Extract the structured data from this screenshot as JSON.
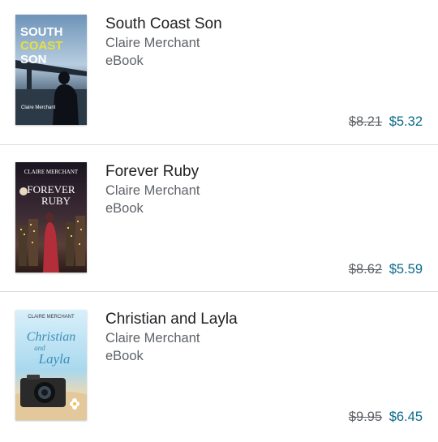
{
  "items": [
    {
      "title": "South Coast Son",
      "author": "Claire Merchant",
      "format": "eBook",
      "old_price": "$8.21",
      "new_price": "$5.32",
      "cover": {
        "line1": "SOUTH",
        "line2": "COAST",
        "line3": "SON",
        "author": "Claire Merchant",
        "bg_color": "#7fa4c6",
        "accent_color": "#e8e03a"
      }
    },
    {
      "title": "Forever Ruby",
      "author": "Claire Merchant",
      "format": "eBook",
      "old_price": "$8.62",
      "new_price": "$5.59",
      "cover": {
        "author": "CLAIRE MERCHANT",
        "line1": "FOREVER",
        "line2": "RUBY",
        "bg_color": "#2a1e24",
        "accent_color": "#d14a52"
      }
    },
    {
      "title": "Christian and Layla",
      "author": "Claire Merchant",
      "format": "eBook",
      "old_price": "$9.95",
      "new_price": "$6.45",
      "cover": {
        "author": "CLAIRE MERCHANT",
        "line1": "Christian",
        "line2": "and",
        "line3": "Layla",
        "bg_color": "#bde3f2",
        "accent_color": "#3a8fb8"
      }
    }
  ]
}
